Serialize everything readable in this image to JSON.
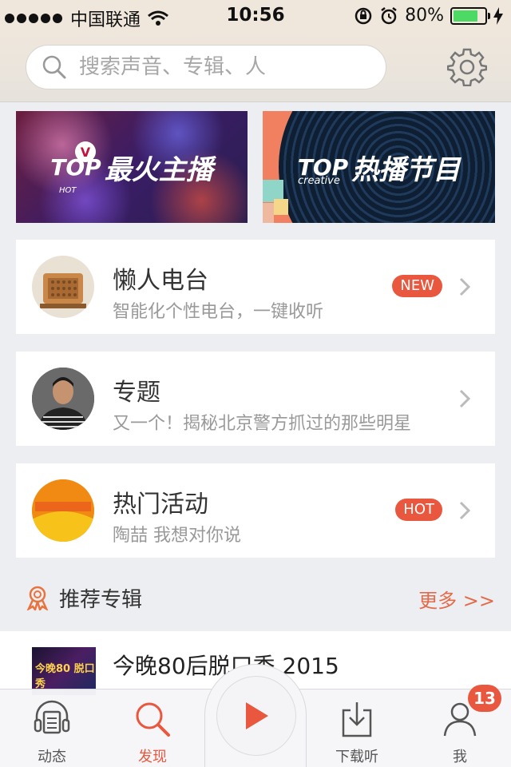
{
  "status_bar": {
    "carrier": "中国联通",
    "time": "10:56",
    "battery_percent": "80%",
    "battery_level": 0.8
  },
  "search": {
    "placeholder": "搜索声音、专辑、人"
  },
  "banners": [
    {
      "tag": "TOP",
      "title": "最火主播",
      "subtag": "HOT"
    },
    {
      "tag": "TOP",
      "title": "热播节目",
      "subtag": "creative"
    }
  ],
  "cards": [
    {
      "title": "懒人电台",
      "subtitle": "智能化个性电台，一键收听",
      "pill": "NEW"
    },
    {
      "title": "专题",
      "subtitle": "又一个！揭秘北京警方抓过的那些明星",
      "pill": ""
    },
    {
      "title": "热门活动",
      "subtitle": "陶喆 我想对你说",
      "pill": "HOT"
    }
  ],
  "recommend": {
    "label": "推荐专辑",
    "more": "更多 >>"
  },
  "album": {
    "title": "今晚80后脱口秀 2015",
    "cover_text": "今晚80 脱口秀"
  },
  "tabbar": {
    "tabs": [
      {
        "label": "动态",
        "icon": "news-feed-icon"
      },
      {
        "label": "发现",
        "icon": "search-icon"
      },
      {
        "label": "下载听",
        "icon": "download-icon"
      },
      {
        "label": "我",
        "icon": "person-icon"
      }
    ],
    "me_badge": "13"
  },
  "colors": {
    "accent": "#e9573f",
    "status_bg": "#efe7dc",
    "battery": "#4cd964"
  }
}
